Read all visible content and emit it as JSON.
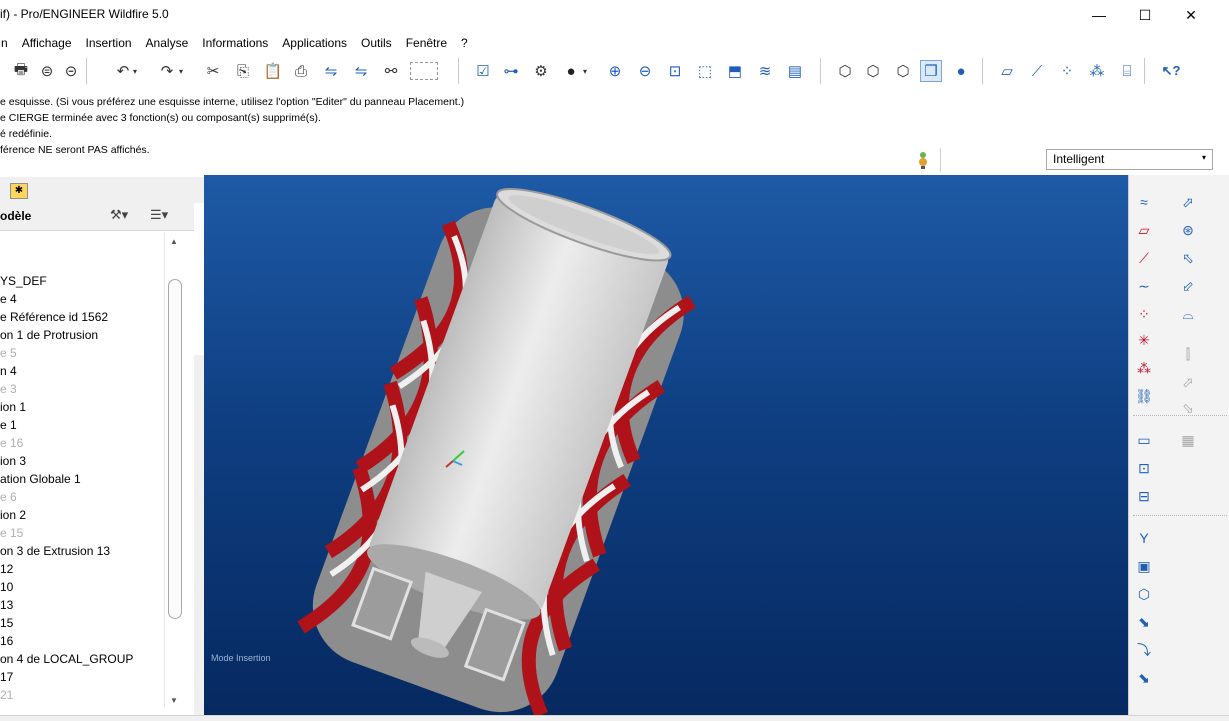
{
  "window": {
    "title": "if) - Pro/ENGINEER Wildfire 5.0",
    "min_glyph": "—",
    "max_glyph": "☐",
    "close_glyph": "✕"
  },
  "menu": [
    "n",
    "Affichage",
    "Insertion",
    "Analyse",
    "Informations",
    "Applications",
    "Outils",
    "Fenêtre",
    "?"
  ],
  "toolbar_icons": [
    "new-icon",
    "open-icon",
    "save-icon",
    "print-icon",
    "email-icon",
    "undo-icon",
    "redo-icon",
    "cut-icon",
    "copy-icon",
    "paste-icon",
    "paste-special-icon",
    "regenerate-icon",
    "regenerate-manager-icon",
    "find-icon",
    "select-box-icon",
    "edit-definition-icon",
    "sketch-icon",
    "display-axes-icon",
    "shading-icon",
    "zoom-in-icon",
    "zoom-out-icon",
    "refit-icon",
    "reorient-icon",
    "saved-views-icon",
    "layers-icon",
    "view-manager-icon",
    "wireframe-icon",
    "hidden-line-icon",
    "no-hidden-icon",
    "shading-mode-icon",
    "enhanced-realism-icon",
    "datum-planes-icon",
    "datum-axes-icon",
    "datum-points-icon",
    "coordinate-systems-icon",
    "annotations-icon",
    "context-help-icon"
  ],
  "messages": [
    "e esquisse. (Si vous préférez une esquisse interne, utilisez l'option \"Editer\" du panneau Placement.)",
    "e CIERGE terminée avec 3 fonction(s) ou composant(s) supprimé(s).",
    "é redéfinie.",
    "férence NE seront PAS affichés."
  ],
  "smart_filter": {
    "value": "Intelligent",
    "arrow": "▾"
  },
  "model_tree": {
    "header": "odèle",
    "items": [
      {
        "label": "YS_DEF",
        "grey": false
      },
      {
        "label": "e 4",
        "grey": false
      },
      {
        "label": "e Référence id 1562",
        "grey": false
      },
      {
        "label": "on 1 de Protrusion",
        "grey": false
      },
      {
        "label": "e 5",
        "grey": true
      },
      {
        "label": "n 4",
        "grey": false
      },
      {
        "label": "e 3",
        "grey": true
      },
      {
        "label": "ion 1",
        "grey": false
      },
      {
        "label": "e 1",
        "grey": false
      },
      {
        "label": "e 16",
        "grey": true
      },
      {
        "label": "ion 3",
        "grey": false
      },
      {
        "label": "ation Globale 1",
        "grey": false
      },
      {
        "label": "e 6",
        "grey": true
      },
      {
        "label": "ion 2",
        "grey": false
      },
      {
        "label": "e 15",
        "grey": true
      },
      {
        "label": "on 3 de Extrusion 13",
        "grey": false
      },
      {
        "label": "12",
        "grey": false
      },
      {
        "label": "10",
        "grey": false
      },
      {
        "label": "13",
        "grey": false
      },
      {
        "label": "15",
        "grey": false
      },
      {
        "label": "16",
        "grey": false
      },
      {
        "label": "on 4 de LOCAL_GROUP",
        "grey": false
      },
      {
        "label": "17",
        "grey": false
      },
      {
        "label": "21",
        "grey": true
      }
    ]
  },
  "graphics": {
    "mode_label": "Mode Insertion"
  },
  "colors": {
    "accent_blue": "#1f5fb8",
    "viewport_top": "#1e5aa6",
    "viewport_bottom": "#062960",
    "model_red": "#b0121a",
    "model_white": "#e6e6e6"
  }
}
